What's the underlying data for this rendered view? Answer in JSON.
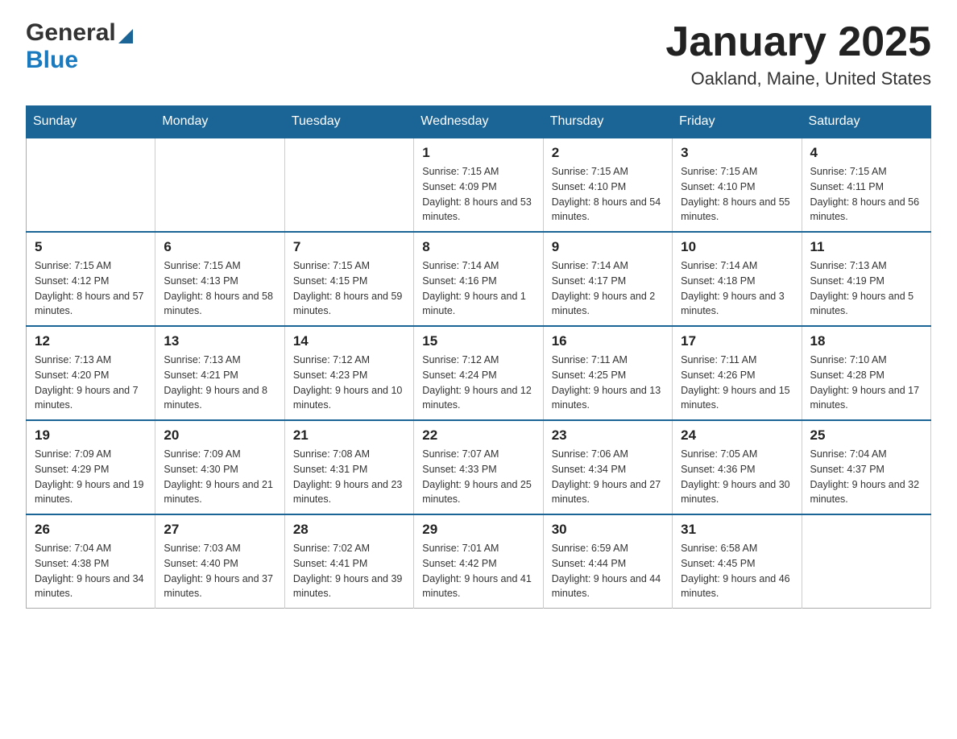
{
  "header": {
    "logo_general": "General",
    "logo_blue": "Blue",
    "month_title": "January 2025",
    "location": "Oakland, Maine, United States"
  },
  "days_of_week": [
    "Sunday",
    "Monday",
    "Tuesday",
    "Wednesday",
    "Thursday",
    "Friday",
    "Saturday"
  ],
  "weeks": [
    [
      {
        "day": "",
        "sunrise": "",
        "sunset": "",
        "daylight": ""
      },
      {
        "day": "",
        "sunrise": "",
        "sunset": "",
        "daylight": ""
      },
      {
        "day": "",
        "sunrise": "",
        "sunset": "",
        "daylight": ""
      },
      {
        "day": "1",
        "sunrise": "Sunrise: 7:15 AM",
        "sunset": "Sunset: 4:09 PM",
        "daylight": "Daylight: 8 hours and 53 minutes."
      },
      {
        "day": "2",
        "sunrise": "Sunrise: 7:15 AM",
        "sunset": "Sunset: 4:10 PM",
        "daylight": "Daylight: 8 hours and 54 minutes."
      },
      {
        "day": "3",
        "sunrise": "Sunrise: 7:15 AM",
        "sunset": "Sunset: 4:10 PM",
        "daylight": "Daylight: 8 hours and 55 minutes."
      },
      {
        "day": "4",
        "sunrise": "Sunrise: 7:15 AM",
        "sunset": "Sunset: 4:11 PM",
        "daylight": "Daylight: 8 hours and 56 minutes."
      }
    ],
    [
      {
        "day": "5",
        "sunrise": "Sunrise: 7:15 AM",
        "sunset": "Sunset: 4:12 PM",
        "daylight": "Daylight: 8 hours and 57 minutes."
      },
      {
        "day": "6",
        "sunrise": "Sunrise: 7:15 AM",
        "sunset": "Sunset: 4:13 PM",
        "daylight": "Daylight: 8 hours and 58 minutes."
      },
      {
        "day": "7",
        "sunrise": "Sunrise: 7:15 AM",
        "sunset": "Sunset: 4:15 PM",
        "daylight": "Daylight: 8 hours and 59 minutes."
      },
      {
        "day": "8",
        "sunrise": "Sunrise: 7:14 AM",
        "sunset": "Sunset: 4:16 PM",
        "daylight": "Daylight: 9 hours and 1 minute."
      },
      {
        "day": "9",
        "sunrise": "Sunrise: 7:14 AM",
        "sunset": "Sunset: 4:17 PM",
        "daylight": "Daylight: 9 hours and 2 minutes."
      },
      {
        "day": "10",
        "sunrise": "Sunrise: 7:14 AM",
        "sunset": "Sunset: 4:18 PM",
        "daylight": "Daylight: 9 hours and 3 minutes."
      },
      {
        "day": "11",
        "sunrise": "Sunrise: 7:13 AM",
        "sunset": "Sunset: 4:19 PM",
        "daylight": "Daylight: 9 hours and 5 minutes."
      }
    ],
    [
      {
        "day": "12",
        "sunrise": "Sunrise: 7:13 AM",
        "sunset": "Sunset: 4:20 PM",
        "daylight": "Daylight: 9 hours and 7 minutes."
      },
      {
        "day": "13",
        "sunrise": "Sunrise: 7:13 AM",
        "sunset": "Sunset: 4:21 PM",
        "daylight": "Daylight: 9 hours and 8 minutes."
      },
      {
        "day": "14",
        "sunrise": "Sunrise: 7:12 AM",
        "sunset": "Sunset: 4:23 PM",
        "daylight": "Daylight: 9 hours and 10 minutes."
      },
      {
        "day": "15",
        "sunrise": "Sunrise: 7:12 AM",
        "sunset": "Sunset: 4:24 PM",
        "daylight": "Daylight: 9 hours and 12 minutes."
      },
      {
        "day": "16",
        "sunrise": "Sunrise: 7:11 AM",
        "sunset": "Sunset: 4:25 PM",
        "daylight": "Daylight: 9 hours and 13 minutes."
      },
      {
        "day": "17",
        "sunrise": "Sunrise: 7:11 AM",
        "sunset": "Sunset: 4:26 PM",
        "daylight": "Daylight: 9 hours and 15 minutes."
      },
      {
        "day": "18",
        "sunrise": "Sunrise: 7:10 AM",
        "sunset": "Sunset: 4:28 PM",
        "daylight": "Daylight: 9 hours and 17 minutes."
      }
    ],
    [
      {
        "day": "19",
        "sunrise": "Sunrise: 7:09 AM",
        "sunset": "Sunset: 4:29 PM",
        "daylight": "Daylight: 9 hours and 19 minutes."
      },
      {
        "day": "20",
        "sunrise": "Sunrise: 7:09 AM",
        "sunset": "Sunset: 4:30 PM",
        "daylight": "Daylight: 9 hours and 21 minutes."
      },
      {
        "day": "21",
        "sunrise": "Sunrise: 7:08 AM",
        "sunset": "Sunset: 4:31 PM",
        "daylight": "Daylight: 9 hours and 23 minutes."
      },
      {
        "day": "22",
        "sunrise": "Sunrise: 7:07 AM",
        "sunset": "Sunset: 4:33 PM",
        "daylight": "Daylight: 9 hours and 25 minutes."
      },
      {
        "day": "23",
        "sunrise": "Sunrise: 7:06 AM",
        "sunset": "Sunset: 4:34 PM",
        "daylight": "Daylight: 9 hours and 27 minutes."
      },
      {
        "day": "24",
        "sunrise": "Sunrise: 7:05 AM",
        "sunset": "Sunset: 4:36 PM",
        "daylight": "Daylight: 9 hours and 30 minutes."
      },
      {
        "day": "25",
        "sunrise": "Sunrise: 7:04 AM",
        "sunset": "Sunset: 4:37 PM",
        "daylight": "Daylight: 9 hours and 32 minutes."
      }
    ],
    [
      {
        "day": "26",
        "sunrise": "Sunrise: 7:04 AM",
        "sunset": "Sunset: 4:38 PM",
        "daylight": "Daylight: 9 hours and 34 minutes."
      },
      {
        "day": "27",
        "sunrise": "Sunrise: 7:03 AM",
        "sunset": "Sunset: 4:40 PM",
        "daylight": "Daylight: 9 hours and 37 minutes."
      },
      {
        "day": "28",
        "sunrise": "Sunrise: 7:02 AM",
        "sunset": "Sunset: 4:41 PM",
        "daylight": "Daylight: 9 hours and 39 minutes."
      },
      {
        "day": "29",
        "sunrise": "Sunrise: 7:01 AM",
        "sunset": "Sunset: 4:42 PM",
        "daylight": "Daylight: 9 hours and 41 minutes."
      },
      {
        "day": "30",
        "sunrise": "Sunrise: 6:59 AM",
        "sunset": "Sunset: 4:44 PM",
        "daylight": "Daylight: 9 hours and 44 minutes."
      },
      {
        "day": "31",
        "sunrise": "Sunrise: 6:58 AM",
        "sunset": "Sunset: 4:45 PM",
        "daylight": "Daylight: 9 hours and 46 minutes."
      },
      {
        "day": "",
        "sunrise": "",
        "sunset": "",
        "daylight": ""
      }
    ]
  ]
}
